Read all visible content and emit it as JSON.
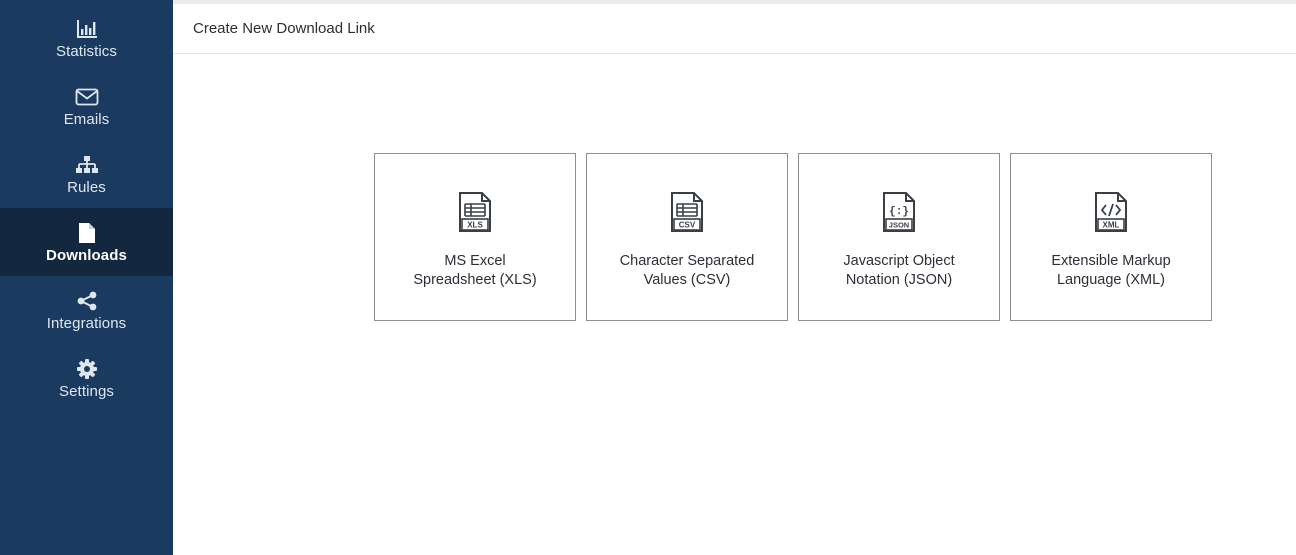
{
  "sidebar": {
    "items": [
      {
        "label": "Statistics",
        "icon": "bar-chart-icon",
        "active": false
      },
      {
        "label": "Emails",
        "icon": "envelope-icon",
        "active": false
      },
      {
        "label": "Rules",
        "icon": "sitemap-icon",
        "active": false
      },
      {
        "label": "Downloads",
        "icon": "file-icon",
        "active": true
      },
      {
        "label": "Integrations",
        "icon": "share-icon",
        "active": false
      },
      {
        "label": "Settings",
        "icon": "gear-icon",
        "active": false
      }
    ]
  },
  "header": {
    "title": "Create New Download Link"
  },
  "formats": [
    {
      "label_line1": "MS Excel",
      "label_line2": "Spreadsheet (XLS)",
      "badge": "XLS",
      "icon": "xls-file-icon"
    },
    {
      "label_line1": "Character Separated",
      "label_line2": "Values (CSV)",
      "badge": "CSV",
      "icon": "csv-file-icon"
    },
    {
      "label_line1": "Javascript Object",
      "label_line2": "Notation (JSON)",
      "badge": "JSON",
      "icon": "json-file-icon"
    },
    {
      "label_line1": "Extensible Markup",
      "label_line2": "Language (XML)",
      "badge": "XML",
      "icon": "xml-file-icon"
    }
  ],
  "colors": {
    "sidebar_bg": "#1a3a5f",
    "sidebar_active_bg": "#13273f",
    "card_border": "#8c9096",
    "icon_color": "#3a3f46"
  }
}
